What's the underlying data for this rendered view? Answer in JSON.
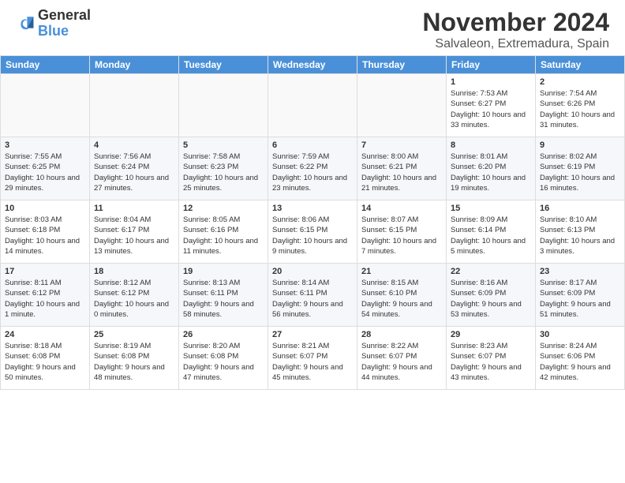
{
  "logo": {
    "line1": "General",
    "line2": "Blue"
  },
  "title": "November 2024",
  "subtitle": "Salvaleon, Extremadura, Spain",
  "weekdays": [
    "Sunday",
    "Monday",
    "Tuesday",
    "Wednesday",
    "Thursday",
    "Friday",
    "Saturday"
  ],
  "weeks": [
    [
      {
        "day": "",
        "info": ""
      },
      {
        "day": "",
        "info": ""
      },
      {
        "day": "",
        "info": ""
      },
      {
        "day": "",
        "info": ""
      },
      {
        "day": "",
        "info": ""
      },
      {
        "day": "1",
        "info": "Sunrise: 7:53 AM\nSunset: 6:27 PM\nDaylight: 10 hours and 33 minutes."
      },
      {
        "day": "2",
        "info": "Sunrise: 7:54 AM\nSunset: 6:26 PM\nDaylight: 10 hours and 31 minutes."
      }
    ],
    [
      {
        "day": "3",
        "info": "Sunrise: 7:55 AM\nSunset: 6:25 PM\nDaylight: 10 hours and 29 minutes."
      },
      {
        "day": "4",
        "info": "Sunrise: 7:56 AM\nSunset: 6:24 PM\nDaylight: 10 hours and 27 minutes."
      },
      {
        "day": "5",
        "info": "Sunrise: 7:58 AM\nSunset: 6:23 PM\nDaylight: 10 hours and 25 minutes."
      },
      {
        "day": "6",
        "info": "Sunrise: 7:59 AM\nSunset: 6:22 PM\nDaylight: 10 hours and 23 minutes."
      },
      {
        "day": "7",
        "info": "Sunrise: 8:00 AM\nSunset: 6:21 PM\nDaylight: 10 hours and 21 minutes."
      },
      {
        "day": "8",
        "info": "Sunrise: 8:01 AM\nSunset: 6:20 PM\nDaylight: 10 hours and 19 minutes."
      },
      {
        "day": "9",
        "info": "Sunrise: 8:02 AM\nSunset: 6:19 PM\nDaylight: 10 hours and 16 minutes."
      }
    ],
    [
      {
        "day": "10",
        "info": "Sunrise: 8:03 AM\nSunset: 6:18 PM\nDaylight: 10 hours and 14 minutes."
      },
      {
        "day": "11",
        "info": "Sunrise: 8:04 AM\nSunset: 6:17 PM\nDaylight: 10 hours and 13 minutes."
      },
      {
        "day": "12",
        "info": "Sunrise: 8:05 AM\nSunset: 6:16 PM\nDaylight: 10 hours and 11 minutes."
      },
      {
        "day": "13",
        "info": "Sunrise: 8:06 AM\nSunset: 6:15 PM\nDaylight: 10 hours and 9 minutes."
      },
      {
        "day": "14",
        "info": "Sunrise: 8:07 AM\nSunset: 6:15 PM\nDaylight: 10 hours and 7 minutes."
      },
      {
        "day": "15",
        "info": "Sunrise: 8:09 AM\nSunset: 6:14 PM\nDaylight: 10 hours and 5 minutes."
      },
      {
        "day": "16",
        "info": "Sunrise: 8:10 AM\nSunset: 6:13 PM\nDaylight: 10 hours and 3 minutes."
      }
    ],
    [
      {
        "day": "17",
        "info": "Sunrise: 8:11 AM\nSunset: 6:12 PM\nDaylight: 10 hours and 1 minute."
      },
      {
        "day": "18",
        "info": "Sunrise: 8:12 AM\nSunset: 6:12 PM\nDaylight: 10 hours and 0 minutes."
      },
      {
        "day": "19",
        "info": "Sunrise: 8:13 AM\nSunset: 6:11 PM\nDaylight: 9 hours and 58 minutes."
      },
      {
        "day": "20",
        "info": "Sunrise: 8:14 AM\nSunset: 6:11 PM\nDaylight: 9 hours and 56 minutes."
      },
      {
        "day": "21",
        "info": "Sunrise: 8:15 AM\nSunset: 6:10 PM\nDaylight: 9 hours and 54 minutes."
      },
      {
        "day": "22",
        "info": "Sunrise: 8:16 AM\nSunset: 6:09 PM\nDaylight: 9 hours and 53 minutes."
      },
      {
        "day": "23",
        "info": "Sunrise: 8:17 AM\nSunset: 6:09 PM\nDaylight: 9 hours and 51 minutes."
      }
    ],
    [
      {
        "day": "24",
        "info": "Sunrise: 8:18 AM\nSunset: 6:08 PM\nDaylight: 9 hours and 50 minutes."
      },
      {
        "day": "25",
        "info": "Sunrise: 8:19 AM\nSunset: 6:08 PM\nDaylight: 9 hours and 48 minutes."
      },
      {
        "day": "26",
        "info": "Sunrise: 8:20 AM\nSunset: 6:08 PM\nDaylight: 9 hours and 47 minutes."
      },
      {
        "day": "27",
        "info": "Sunrise: 8:21 AM\nSunset: 6:07 PM\nDaylight: 9 hours and 45 minutes."
      },
      {
        "day": "28",
        "info": "Sunrise: 8:22 AM\nSunset: 6:07 PM\nDaylight: 9 hours and 44 minutes."
      },
      {
        "day": "29",
        "info": "Sunrise: 8:23 AM\nSunset: 6:07 PM\nDaylight: 9 hours and 43 minutes."
      },
      {
        "day": "30",
        "info": "Sunrise: 8:24 AM\nSunset: 6:06 PM\nDaylight: 9 hours and 42 minutes."
      }
    ]
  ]
}
